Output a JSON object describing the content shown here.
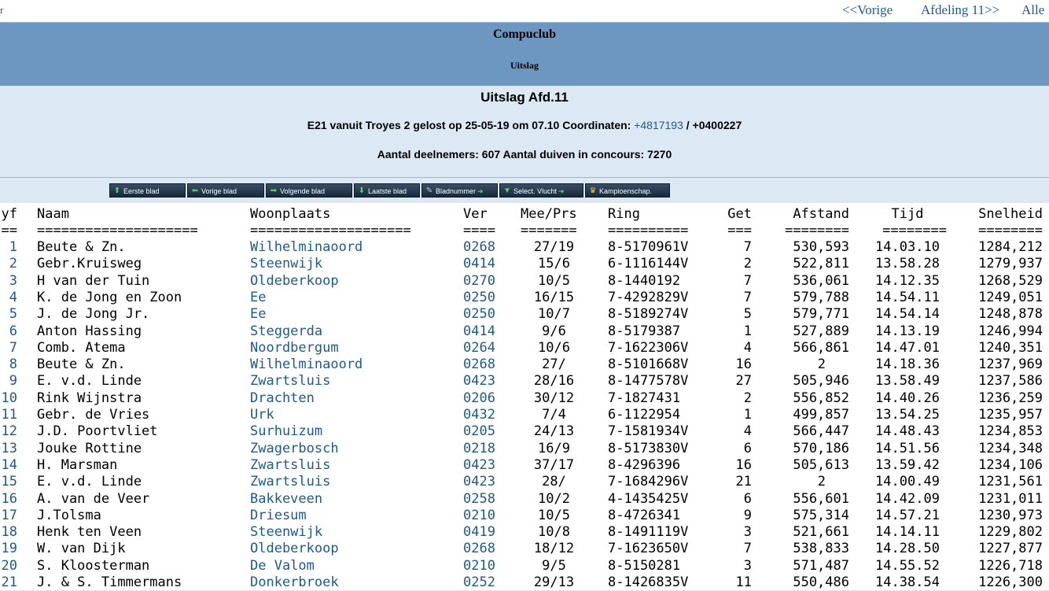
{
  "nav": {
    "left": "r",
    "prev": "<<Vorige",
    "next": "Afdeling 11>>",
    "all": "Alle"
  },
  "banner": {
    "title": "Compuclub",
    "subtitle": "Uitslag"
  },
  "info": {
    "heading": "Uitslag Afd.11",
    "flight_prefix": "E21 vanuit Troyes 2 gelost op 25-05-19 om 07.10 Coordinaten: ",
    "coord1": "+4817193",
    "coord2": " / +0400227",
    "participants": "Aantal deelnemers: 607 Aantal duiven in concours: 7270"
  },
  "buttons": [
    {
      "label": "Eerste blad",
      "icon": "arrow-up-icon"
    },
    {
      "label": "Vorige blad",
      "icon": "arrow-left-icon"
    },
    {
      "label": "Volgende blad",
      "icon": "arrow-right-icon"
    },
    {
      "label": "Laatste blad",
      "icon": "arrow-down-icon"
    },
    {
      "label": "Bladnummer",
      "icon": "wrench-icon"
    },
    {
      "label": "Select. Vlucht",
      "icon": "download-icon"
    },
    {
      "label": "Kampioenschap.",
      "icon": "crown-icon"
    }
  ],
  "headers": {
    "pos": "yf",
    "naam": "Naam",
    "woonplaats": "Woonplaats",
    "ver": "Ver",
    "meeprs": "Mee/Prs",
    "ring": "Ring",
    "get": "Get",
    "afstand": "Afstand",
    "tijd": "Tijd",
    "snelheid": "Snelheid"
  },
  "underlines": {
    "pos": "==",
    "naam": "====================",
    "woonplaats": "====================",
    "ver": "====",
    "meeprs": "=======",
    "ring": "==========",
    "get": "===",
    "afstand": "========",
    "tijd": "========",
    "snelheid": "========"
  },
  "rows": [
    {
      "pos": "1",
      "naam": "Beute & Zn.",
      "woonplaats": "Wilhelminaoord",
      "ver": "0268",
      "meeprs": "27/19",
      "ring": "8-5170961V",
      "get": "7",
      "afstand": "530,593",
      "tijd": "14.03.10",
      "snelheid": "1284,212"
    },
    {
      "pos": "2",
      "naam": "Gebr.Kruisweg",
      "woonplaats": "Steenwijk",
      "ver": "0414",
      "meeprs": "15/6",
      "ring": "6-1116144V",
      "get": "2",
      "afstand": "522,811",
      "tijd": "13.58.28",
      "snelheid": "1279,937"
    },
    {
      "pos": "3",
      "naam": "H van der Tuin",
      "woonplaats": "Oldeberkoop",
      "ver": "0270",
      "meeprs": "10/5",
      "ring": "8-1440192",
      "get": "7",
      "afstand": "536,061",
      "tijd": "14.12.35",
      "snelheid": "1268,529"
    },
    {
      "pos": "4",
      "naam": "K. de Jong en Zoon",
      "woonplaats": "Ee",
      "ver": "0250",
      "meeprs": "16/15",
      "ring": "7-4292829V",
      "get": "7",
      "afstand": "579,788",
      "tijd": "14.54.11",
      "snelheid": "1249,051"
    },
    {
      "pos": "5",
      "naam": "J. de Jong Jr.",
      "woonplaats": "Ee",
      "ver": "0250",
      "meeprs": "10/7",
      "ring": "8-5189274V",
      "get": "5",
      "afstand": "579,771",
      "tijd": "14.54.14",
      "snelheid": "1248,878"
    },
    {
      "pos": "6",
      "naam": "Anton Hassing",
      "woonplaats": "Steggerda",
      "ver": "0414",
      "meeprs": "9/6",
      "ring": "8-5179387",
      "get": "1",
      "afstand": "527,889",
      "tijd": "14.13.19",
      "snelheid": "1246,994"
    },
    {
      "pos": "7",
      "naam": "Comb. Atema",
      "woonplaats": "Noordbergum",
      "ver": "0264",
      "meeprs": "10/6",
      "ring": "7-1622306V",
      "get": "4",
      "afstand": "566,861",
      "tijd": "14.47.01",
      "snelheid": "1240,351"
    },
    {
      "pos": "8",
      "naam": "Beute & Zn.",
      "woonplaats": "Wilhelminaoord",
      "ver": "0268",
      "meeprs": "27/",
      "ring": "8-5101668V",
      "get": "16",
      "afstand": "2",
      "tijd": "14.18.36",
      "snelheid": "1237,969"
    },
    {
      "pos": "9",
      "naam": "E. v.d. Linde",
      "woonplaats": "Zwartsluis",
      "ver": "0423",
      "meeprs": "28/16",
      "ring": "8-1477578V",
      "get": "27",
      "afstand": "505,946",
      "tijd": "13.58.49",
      "snelheid": "1237,586"
    },
    {
      "pos": "10",
      "naam": "Rink Wijnstra",
      "woonplaats": "Drachten",
      "ver": "0206",
      "meeprs": "30/12",
      "ring": "7-1827431",
      "get": "2",
      "afstand": "556,852",
      "tijd": "14.40.26",
      "snelheid": "1236,259"
    },
    {
      "pos": "11",
      "naam": "Gebr. de Vries",
      "woonplaats": "Urk",
      "ver": "0432",
      "meeprs": "7/4",
      "ring": "6-1122954",
      "get": "1",
      "afstand": "499,857",
      "tijd": "13.54.25",
      "snelheid": "1235,957"
    },
    {
      "pos": "12",
      "naam": "J.D. Poortvliet",
      "woonplaats": "Surhuizum",
      "ver": "0205",
      "meeprs": "24/13",
      "ring": "7-1581934V",
      "get": "4",
      "afstand": "566,447",
      "tijd": "14.48.43",
      "snelheid": "1234,853"
    },
    {
      "pos": "13",
      "naam": "Jouke Rottine",
      "woonplaats": "Zwagerbosch",
      "ver": "0218",
      "meeprs": "16/9",
      "ring": "8-5173830V",
      "get": "6",
      "afstand": "570,186",
      "tijd": "14.51.56",
      "snelheid": "1234,348"
    },
    {
      "pos": "14",
      "naam": "H. Marsman",
      "woonplaats": "Zwartsluis",
      "ver": "0423",
      "meeprs": "37/17",
      "ring": "8-4296396",
      "get": "16",
      "afstand": "505,613",
      "tijd": "13.59.42",
      "snelheid": "1234,106"
    },
    {
      "pos": "15",
      "naam": "E. v.d. Linde",
      "woonplaats": "Zwartsluis",
      "ver": "0423",
      "meeprs": "28/",
      "ring": "7-1684296V",
      "get": "21",
      "afstand": "2",
      "tijd": "14.00.49",
      "snelheid": "1231,561"
    },
    {
      "pos": "16",
      "naam": "A. van de Veer",
      "woonplaats": "Bakkeveen",
      "ver": "0258",
      "meeprs": "10/2",
      "ring": "4-1435425V",
      "get": "6",
      "afstand": "556,601",
      "tijd": "14.42.09",
      "snelheid": "1231,011"
    },
    {
      "pos": "17",
      "naam": "J.Tolsma",
      "woonplaats": "Driesum",
      "ver": "0210",
      "meeprs": "10/5",
      "ring": "8-4726341",
      "get": "9",
      "afstand": "575,314",
      "tijd": "14.57.21",
      "snelheid": "1230,973"
    },
    {
      "pos": "18",
      "naam": "Henk ten Veen",
      "woonplaats": "Steenwijk",
      "ver": "0419",
      "meeprs": "10/8",
      "ring": "8-1491119V",
      "get": "3",
      "afstand": "521,661",
      "tijd": "14.14.11",
      "snelheid": "1229,802"
    },
    {
      "pos": "19",
      "naam": "W. van Dijk",
      "woonplaats": "Oldeberkoop",
      "ver": "0268",
      "meeprs": "18/12",
      "ring": "7-1623650V",
      "get": "7",
      "afstand": "538,833",
      "tijd": "14.28.50",
      "snelheid": "1227,877"
    },
    {
      "pos": "20",
      "naam": "S. Kloosterman",
      "woonplaats": "De Valom",
      "ver": "0210",
      "meeprs": "9/5",
      "ring": "8-5150281",
      "get": "3",
      "afstand": "571,487",
      "tijd": "14.55.52",
      "snelheid": "1226,718"
    },
    {
      "pos": "21",
      "naam": "J. & S. Timmermans",
      "woonplaats": "Donkerbroek",
      "ver": "0252",
      "meeprs": "29/13",
      "ring": "8-1426835V",
      "get": "11",
      "afstand": "550,486",
      "tijd": "14.38.54",
      "snelheid": "1226,300"
    }
  ]
}
